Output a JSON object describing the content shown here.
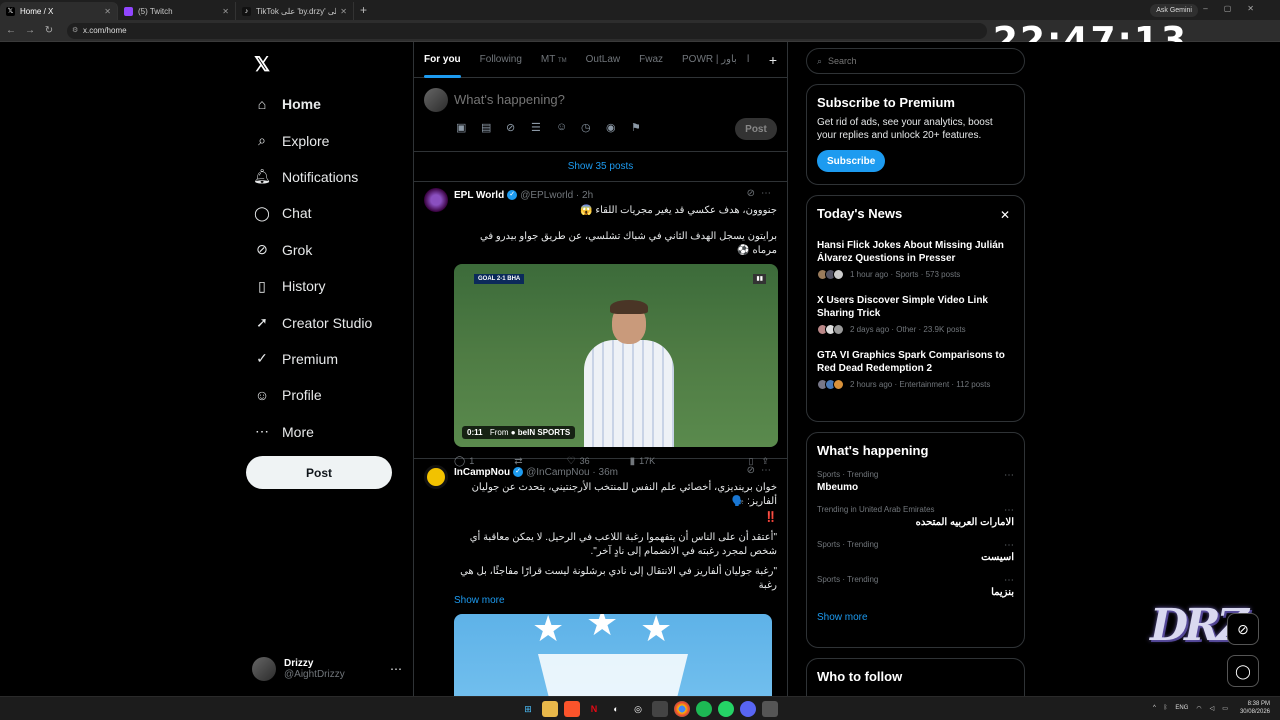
{
  "browser": {
    "tabs": [
      {
        "title": "Home / X",
        "icon": "x-logo-icon",
        "active": true
      },
      {
        "title": "(5) Twitch",
        "icon": "twitch-icon",
        "active": false
      },
      {
        "title": "TikTok على 'by.drzy' اعثر على |",
        "icon": "tiktok-icon",
        "active": false
      }
    ],
    "ask_gemini": "Ask Gemini",
    "url": "x.com/home",
    "overlay_clock": "22:47:13"
  },
  "sidebar": {
    "items": [
      {
        "label": "Home",
        "icon": "home-icon"
      },
      {
        "label": "Explore",
        "icon": "search-icon"
      },
      {
        "label": "Notifications",
        "icon": "bell-icon"
      },
      {
        "label": "Chat",
        "icon": "chat-icon"
      },
      {
        "label": "Grok",
        "icon": "grok-icon"
      },
      {
        "label": "History",
        "icon": "bookmark-icon"
      },
      {
        "label": "Creator Studio",
        "icon": "rocket-icon"
      },
      {
        "label": "Premium",
        "icon": "verified-icon"
      },
      {
        "label": "Profile",
        "icon": "person-icon"
      },
      {
        "label": "More",
        "icon": "more-circle-icon"
      }
    ],
    "post_label": "Post",
    "profile": {
      "name": "Drizzy",
      "handle": "@AightDrizzy"
    }
  },
  "feed": {
    "tabs": [
      "For you",
      "Following",
      "MT",
      "OutLaw",
      "Fwaz",
      "POWR | باور",
      "ا"
    ],
    "tab_suffix": "TM",
    "composer_placeholder": "What's happening?",
    "composer_post": "Post",
    "show_posts": "Show 35 posts",
    "tweets": [
      {
        "name": "EPL World",
        "handle": "@EPLworld",
        "time": "2h",
        "line1": "جنووون، هدف عكسي قد يغير مجريات اللقاء 😱",
        "line2": "برايتون يسجل الهدف الثاني في شباك تشلسي، عن طريق جواو بيدرو في مرماه ⚽",
        "video_time": "0:11",
        "video_from": "From",
        "video_source": "beIN SPORTS",
        "score_overlay": "GOAL 2-1 BHA",
        "replies": "1",
        "likes": "36",
        "views": "17K"
      },
      {
        "name": "InCampNou",
        "handle": "@InCampNou",
        "time": "36m",
        "line1": "خوان برينديزي، أخصائي علم النفس للمنتخب الأرجنتيني، يتحدث عن جوليان ألفاريز: 🗣️",
        "line2": "‼️",
        "line3": "\"أعتقد أن على الناس أن يتفهموا رغبة اللاعب في الرحيل. لا يمكن معاقبة أي شخص لمجرد رغبته في الانضمام إلى نادٍ آخر\".",
        "line4": "\"رغبة جوليان ألفاريز في الانتقال إلى نادي برشلونة ليست قرارًا مفاجئًا، بل هي رغبة",
        "show_more": "Show more"
      }
    ]
  },
  "right": {
    "search_placeholder": "Search",
    "premium": {
      "title": "Subscribe to Premium",
      "desc": "Get rid of ads, see your analytics, boost your replies and unlock 20+ features.",
      "button": "Subscribe"
    },
    "news": {
      "title": "Today's News",
      "items": [
        {
          "title": "Hansi Flick Jokes About Missing Julián Álvarez Questions in Presser",
          "meta": "1 hour ago · Sports · 573 posts"
        },
        {
          "title": "X Users Discover Simple Video Link Sharing Trick",
          "meta": "2 days ago · Other · 23.9K posts"
        },
        {
          "title": "GTA VI Graphics Spark Comparisons to Red Dead Redemption 2",
          "meta": "2 hours ago · Entertainment · 112 posts"
        }
      ]
    },
    "happening": {
      "title": "What's happening",
      "items": [
        {
          "context": "Sports · Trending",
          "name": "Mbeumo",
          "rtl": false
        },
        {
          "context": "Trending in United Arab Emirates",
          "name": "الامارات العربيه المتحده",
          "rtl": true
        },
        {
          "context": "Sports · Trending",
          "name": "اسيست",
          "rtl": true
        },
        {
          "context": "Sports · Trending",
          "name": "بنزيما",
          "rtl": true
        }
      ],
      "show_more": "Show more"
    },
    "follow_title": "Who to follow"
  },
  "overlay": {
    "watermark": "DRZ"
  },
  "taskbar": {
    "lang": "ENG",
    "time": "8:38 PM",
    "date": "30/08/2026"
  },
  "colors": {
    "accent": "#1d9bf0",
    "background": "#000000",
    "border": "#2f3336",
    "muted": "#71767b"
  }
}
